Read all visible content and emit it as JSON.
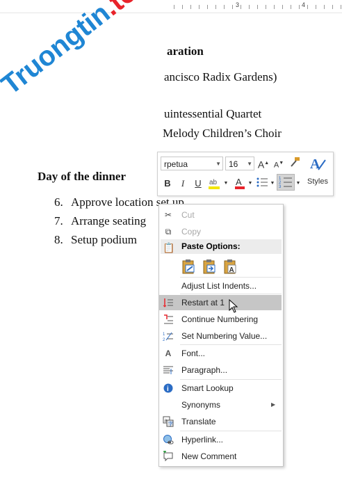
{
  "ruler": {
    "num_3": "3",
    "num_4": "4"
  },
  "document": {
    "heading1_fragment": "aration",
    "line1_fragment": "ancisco Radix Gardens)",
    "line2_fragment": "uintessential Quartet",
    "line3_fragment": "Melody Children’s Choir",
    "section_heading": "Day of the dinner",
    "list": [
      {
        "num": "6.",
        "text": "Approve location set up"
      },
      {
        "num": "7.",
        "text": "Arrange seating"
      },
      {
        "num": "8.",
        "text": "Setup podium"
      }
    ]
  },
  "watermark": {
    "part1": "Truongtin",
    "part2": ".top"
  },
  "mini_toolbar": {
    "font_name": "rpetua",
    "font_size": "16",
    "styles_label": "Styles"
  },
  "context_menu": {
    "items": {
      "cut": "Cut",
      "copy": "Copy",
      "paste_options": "Paste Options:",
      "adjust_list_indents": "Adjust List Indents...",
      "restart_at_1": "Restart at 1",
      "continue_numbering": "Continue Numbering",
      "set_numbering_value": "Set Numbering Value...",
      "font": "Font...",
      "paragraph": "Paragraph...",
      "smart_lookup": "Smart Lookup",
      "synonyms": "Synonyms",
      "translate": "Translate",
      "hyperlink": "Hyperlink...",
      "new_comment": "New Comment"
    }
  },
  "colors": {
    "highlight": "#c6c6c6",
    "accent_blue": "#2b6cc4",
    "font_color_red": "#e8232a",
    "text_highlight_yellow": "#f4e600"
  }
}
